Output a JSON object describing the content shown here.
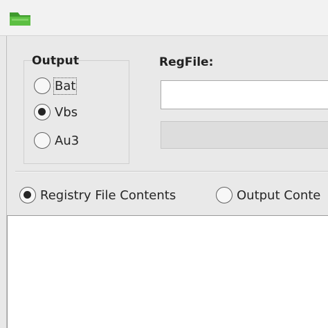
{
  "output_group": {
    "title": "Output",
    "options": [
      {
        "label": "Bat",
        "checked": false
      },
      {
        "label": "Vbs",
        "checked": true
      },
      {
        "label": "Au3",
        "checked": false
      }
    ]
  },
  "regfile": {
    "title": "RegFile:",
    "value": ""
  },
  "view_options": [
    {
      "label": "Registry File Contents",
      "checked": true
    },
    {
      "label": "Output Conte",
      "checked": false
    }
  ],
  "content_text": ""
}
